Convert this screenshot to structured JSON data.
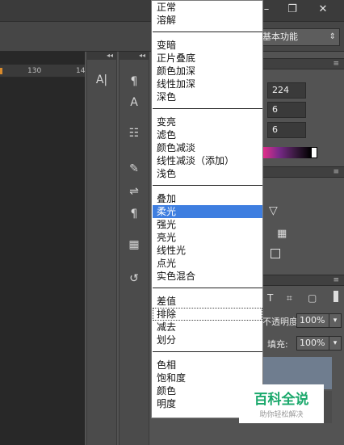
{
  "window": {
    "minimize_label": "–",
    "restore_label": "❐",
    "close_label": "✕"
  },
  "options_bar": {
    "workspace_label": "基本功能"
  },
  "ruler": {
    "ticks": [
      "130",
      "14"
    ]
  },
  "tools_dock_a": {
    "icons": [
      "type-tool-icon"
    ],
    "glyphs": [
      "A|"
    ]
  },
  "tools_dock_b": {
    "glyphs": [
      "¶",
      "A",
      "☷",
      "✎",
      "⇌",
      "¶",
      "▦",
      "↺"
    ]
  },
  "properties": {
    "field1": "224",
    "field2": "6",
    "field3": "6"
  },
  "layers": {
    "opacity_label": "不透明度:",
    "opacity_value": "100%",
    "fill_label": "填充:",
    "fill_value": "100%"
  },
  "blend_menu": {
    "groups": [
      [
        "正常",
        "溶解"
      ],
      [
        "变暗",
        "正片叠底",
        "颜色加深",
        "线性加深",
        "深色"
      ],
      [
        "变亮",
        "滤色",
        "颜色减淡",
        "线性减淡（添加）",
        "浅色"
      ],
      [
        "叠加",
        "柔光",
        "强光",
        "亮光",
        "线性光",
        "点光",
        "实色混合"
      ],
      [
        "差值",
        "排除",
        "减去",
        "划分"
      ],
      [
        "色相",
        "饱和度",
        "颜色",
        "明度"
      ]
    ],
    "selected": "柔光",
    "focused": "排除"
  },
  "watermark": {
    "title": "百科全说",
    "subtitle": "助你轻松解决"
  }
}
